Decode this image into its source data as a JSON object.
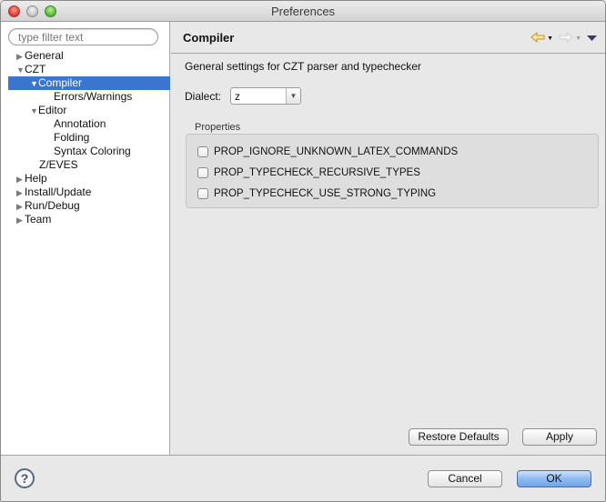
{
  "window": {
    "title": "Preferences"
  },
  "sidebar": {
    "filter_placeholder": "type filter text",
    "filter_value": "",
    "tree": [
      {
        "label": "General",
        "level": 0,
        "expander": "collapsed"
      },
      {
        "label": "CZT",
        "level": 0,
        "expander": "expanded"
      },
      {
        "label": "Compiler",
        "level": 1,
        "expander": "expanded",
        "selected": true
      },
      {
        "label": "Errors/Warnings",
        "level": 2,
        "expander": "none"
      },
      {
        "label": "Editor",
        "level": 1,
        "expander": "expanded"
      },
      {
        "label": "Annotation",
        "level": 2,
        "expander": "none"
      },
      {
        "label": "Folding",
        "level": 2,
        "expander": "none"
      },
      {
        "label": "Syntax Coloring",
        "level": 2,
        "expander": "none"
      },
      {
        "label": "Z/EVES",
        "level": 1,
        "expander": "none"
      },
      {
        "label": "Help",
        "level": 0,
        "expander": "collapsed"
      },
      {
        "label": "Install/Update",
        "level": 0,
        "expander": "collapsed"
      },
      {
        "label": "Run/Debug",
        "level": 0,
        "expander": "collapsed"
      },
      {
        "label": "Team",
        "level": 0,
        "expander": "collapsed"
      }
    ]
  },
  "content": {
    "title": "Compiler",
    "nav": {
      "back_icon": "back-arrow-icon",
      "forward_icon": "forward-arrow-icon",
      "menu_icon": "view-menu-icon"
    },
    "description": "General settings for CZT parser and typechecker",
    "dialect": {
      "label": "Dialect:",
      "value": "z"
    },
    "properties": {
      "label": "Properties",
      "items": [
        {
          "label": "PROP_IGNORE_UNKNOWN_LATEX_COMMANDS",
          "checked": false
        },
        {
          "label": "PROP_TYPECHECK_RECURSIVE_TYPES",
          "checked": false
        },
        {
          "label": "PROP_TYPECHECK_USE_STRONG_TYPING",
          "checked": false
        }
      ]
    },
    "buttons": {
      "restore_defaults": "Restore Defaults",
      "apply": "Apply"
    }
  },
  "footer": {
    "help_icon": "help-icon",
    "cancel": "Cancel",
    "ok": "OK"
  },
  "colors": {
    "selection": "#3a75d0",
    "ok_button": "#8fbaf0",
    "back_arrow": "#f0c05a"
  }
}
